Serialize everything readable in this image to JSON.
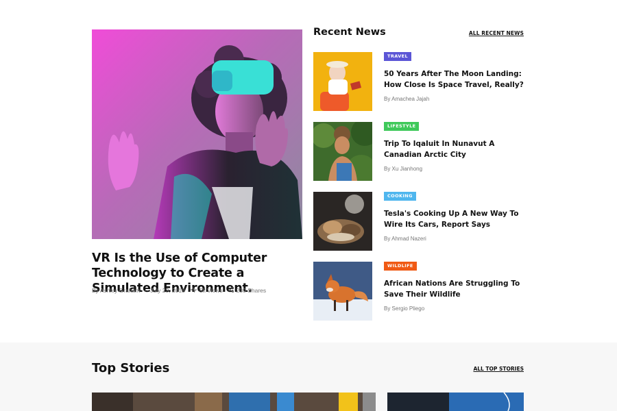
{
  "featured": {
    "title": "VR Is the Use of Computer Technology to Create a Simulated Environment.",
    "author": "By Ashley Graham",
    "date": "July 23, 2019",
    "views": "5k Views",
    "shares": "230 Shares",
    "views_icon": "activity-icon",
    "shares_icon": "share-icon"
  },
  "recent": {
    "heading": "Recent News",
    "all_link": "ALL RECENT NEWS",
    "items": [
      {
        "tag": "TRAVEL",
        "tag_color": "#5b55d6",
        "title": "50 Years After The Moon Landing: How Close Is Space Travel, Really?",
        "author": "By Amachea Jajah"
      },
      {
        "tag": "LIFESTYLE",
        "tag_color": "#3fc95a",
        "title": "Trip To Iqaluit In Nunavut A Canadian Arctic City",
        "author": "By Xu Jianhong"
      },
      {
        "tag": "COOKING",
        "tag_color": "#4fb6ee",
        "title": "Tesla's Cooking Up A New Way To Wire Its Cars, Report Says",
        "author": "By Ahmad Nazeri"
      },
      {
        "tag": "WILDLIFE",
        "tag_color": "#f05a14",
        "title": "African Nations Are Struggling To Save Their Wildlife",
        "author": "By Sergio Pliego"
      }
    ]
  },
  "top_stories": {
    "heading": "Top Stories",
    "all_link": "ALL TOP STORIES"
  }
}
